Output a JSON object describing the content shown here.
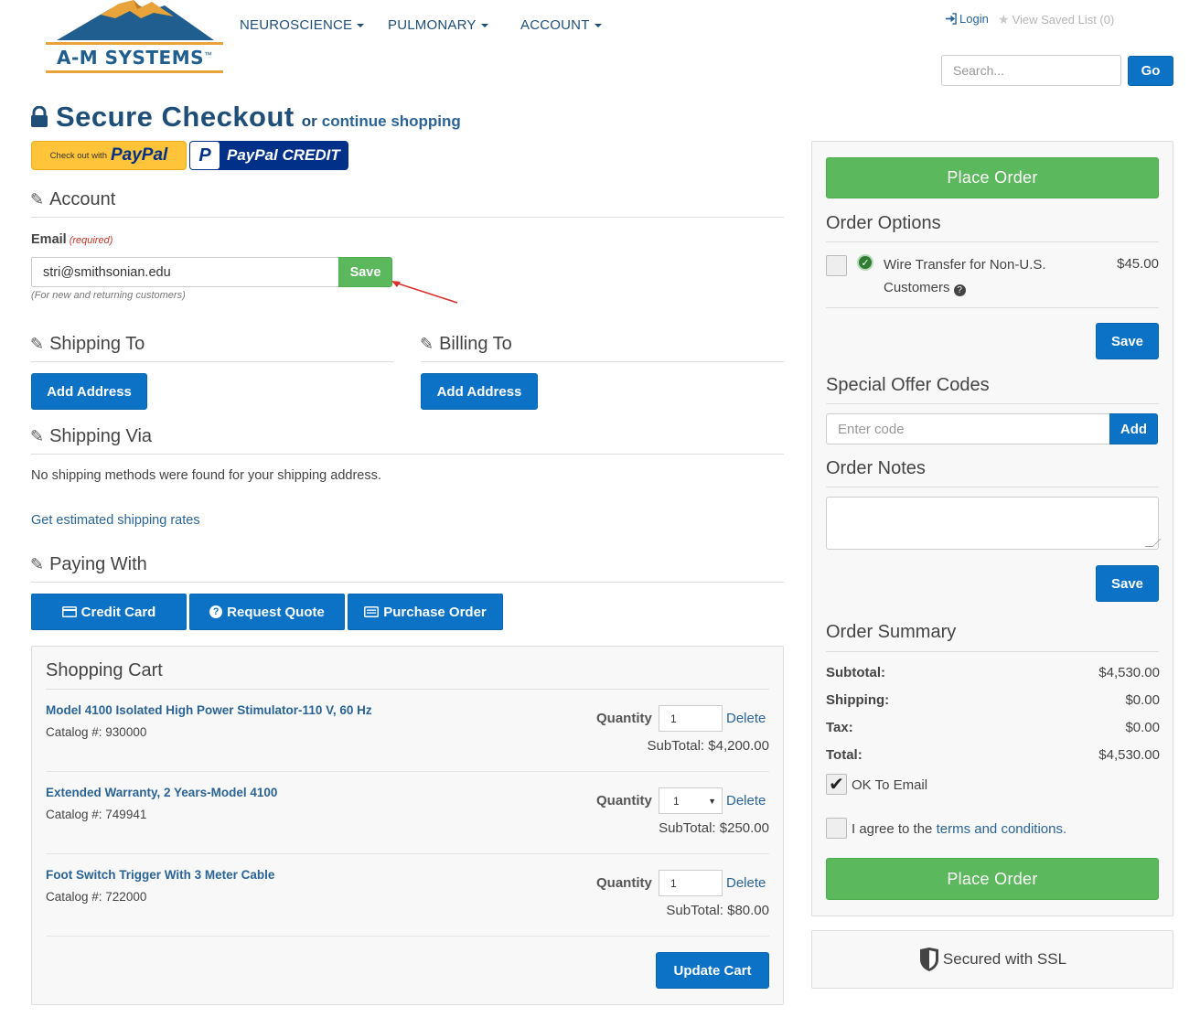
{
  "header": {
    "logo_text": "A-M SYSTEMS",
    "logo_tm": "™",
    "nav": [
      {
        "label": "NEUROSCIENCE"
      },
      {
        "label": "PULMONARY"
      },
      {
        "label": "ACCOUNT"
      }
    ],
    "login_label": "Login",
    "saved_list_label": "View Saved List (0)",
    "search_placeholder": "Search...",
    "search_button": "Go"
  },
  "checkout": {
    "title": "Secure Checkout",
    "or_text": "or",
    "continue_link": "continue shopping",
    "paypal_checkout_small": "Check out with",
    "paypal_checkout_logo": "PayPal",
    "paypal_credit_logo": "PayPal CREDIT"
  },
  "account": {
    "title": "Account",
    "email_label": "Email",
    "required_text": "(required)",
    "email_value": "stri@smithsonian.edu",
    "save_button": "Save",
    "helper_text": "(For new and returning customers)"
  },
  "shipping_to": {
    "title": "Shipping To",
    "button": "Add Address"
  },
  "billing_to": {
    "title": "Billing To",
    "button": "Add Address"
  },
  "shipping_via": {
    "title": "Shipping Via",
    "message": "No shipping methods were found for your shipping address.",
    "rates_link": "Get estimated shipping rates"
  },
  "paying_with": {
    "title": "Paying With",
    "buttons": [
      {
        "label": "Credit Card"
      },
      {
        "label": "Request Quote"
      },
      {
        "label": "Purchase Order"
      }
    ]
  },
  "cart": {
    "title": "Shopping Cart",
    "quantity_label": "Quantity",
    "delete_label": "Delete",
    "items": [
      {
        "name": "Model 4100 Isolated High Power Stimulator-110 V, 60 Hz",
        "catalog": "Catalog #: 930000",
        "qty": "1",
        "subtotal": "SubTotal: $4,200.00"
      },
      {
        "name": "Extended Warranty, 2 Years-Model 4100",
        "catalog": "Catalog #: 749941",
        "qty": "1",
        "subtotal": "SubTotal: $250.00"
      },
      {
        "name": "Foot Switch Trigger With 3 Meter Cable",
        "catalog": "Catalog #: 722000",
        "qty": "1",
        "subtotal": "SubTotal: $80.00"
      }
    ],
    "update_button": "Update Cart"
  },
  "sidebar": {
    "place_order_button": "Place Order",
    "order_options": {
      "title": "Order Options",
      "option_label": "Wire Transfer for Non-U.S. Customers",
      "option_price": "$45.00",
      "save_button": "Save"
    },
    "offer_codes": {
      "title": "Special Offer Codes",
      "placeholder": "Enter code",
      "add_button": "Add"
    },
    "order_notes": {
      "title": "Order Notes",
      "save_button": "Save"
    },
    "summary": {
      "title": "Order Summary",
      "rows": [
        {
          "label": "Subtotal:",
          "value": "$4,530.00"
        },
        {
          "label": "Shipping:",
          "value": "$0.00"
        },
        {
          "label": "Tax:",
          "value": "$0.00"
        },
        {
          "label": "Total:",
          "value": "$4,530.00"
        }
      ],
      "ok_email_label": "OK To Email",
      "agree_prefix": "I agree to the",
      "terms_link": "terms and conditions."
    },
    "ssl_text": "Secured with SSL"
  },
  "colors": {
    "primary_blue": "#0b72c5",
    "green": "#5cb85c",
    "link": "#2a6496",
    "nav": "#1f4e79",
    "required_red": "#c0392b",
    "paypal_gold": "#ffc439",
    "paypal_navy": "#003087"
  }
}
